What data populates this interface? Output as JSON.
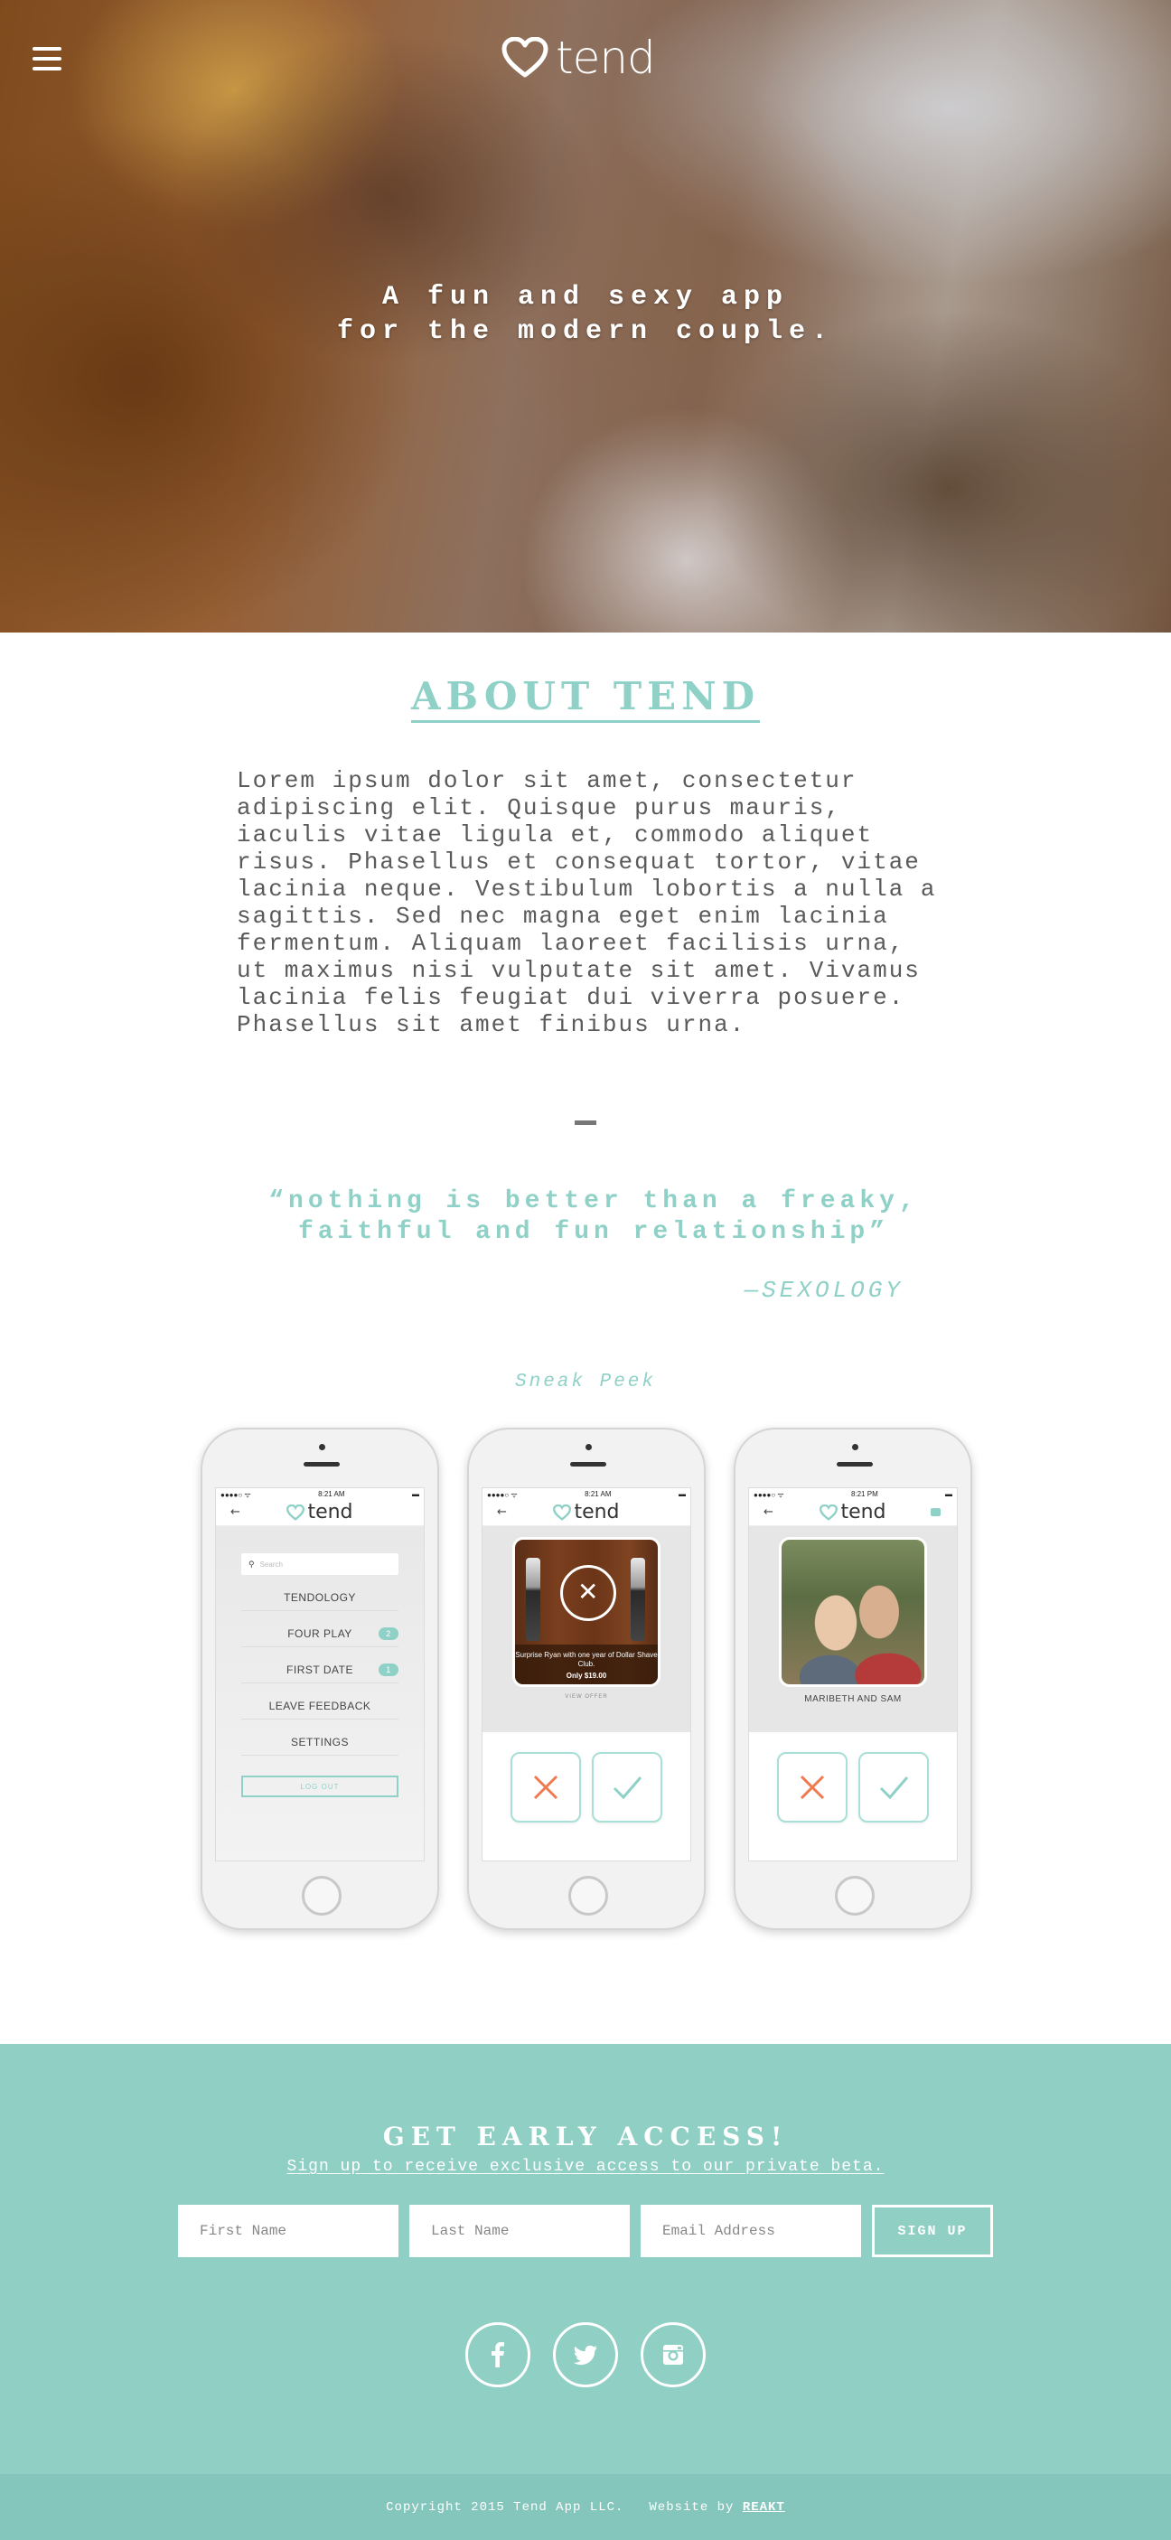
{
  "header": {
    "logo_text": "tend",
    "tagline_line1": "A fun and sexy app",
    "tagline_line2": "for the modern couple."
  },
  "about": {
    "title": "ABOUT TEND",
    "body": "Lorem ipsum dolor sit amet, consectetur adipiscing elit. Quisque purus mauris, iaculis vitae ligula et, commodo aliquet risus. Phasellus et consequat tortor, vitae lacinia neque. Vestibulum lobortis a nulla a sagittis. Sed nec magna eget enim lacinia fermentum. Aliquam laoreet facilisis urna, ut maximus nisi vulputate sit amet. Vivamus lacinia felis feugiat dui viverra posuere. Phasellus sit amet finibus urna."
  },
  "quote": {
    "text_line1": "“nothing is better than a freaky,",
    "text_line2": "faithful and fun relationship”",
    "author": "—SEXOLOGY"
  },
  "sneak_peek": {
    "label": "Sneak Peek",
    "phone1": {
      "time": "8:21 AM",
      "app_logo": "tend",
      "search_placeholder": "Search",
      "menu": [
        {
          "label": "TENDOLOGY",
          "count": ""
        },
        {
          "label": "FOUR PLAY",
          "count": "2"
        },
        {
          "label": "FIRST DATE",
          "count": "1"
        },
        {
          "label": "LEAVE FEEDBACK",
          "count": ""
        },
        {
          "label": "SETTINGS",
          "count": ""
        }
      ],
      "logout_label": "LOG OUT"
    },
    "phone2": {
      "time": "8:21 AM",
      "app_logo": "tend",
      "card_caption": "Surprise Ryan with one year of Dollar Shave Club.",
      "card_price": "Only $19.00",
      "card_sub": "VIEW OFFER"
    },
    "phone3": {
      "time": "8:21 PM",
      "app_logo": "tend",
      "card_name": "MARIBETH AND SAM"
    }
  },
  "signup": {
    "title": "GET EARLY ACCESS!",
    "subtitle": "Sign up to receive exclusive access to our private beta.",
    "first_name_placeholder": "First Name",
    "last_name_placeholder": "Last Name",
    "email_placeholder": "Email Address",
    "button_label": "SIGN UP"
  },
  "social": [
    "facebook-icon",
    "twitter-icon",
    "instagram-icon"
  ],
  "footer": {
    "copyright": "Copyright 2015 Tend App LLC.",
    "website_prefix": "Website by",
    "website_link": "REAKT"
  },
  "colors": {
    "accent": "#8fd1c7",
    "signup_bg": "#8fcfc4",
    "footer_bg": "#85c6bc"
  }
}
